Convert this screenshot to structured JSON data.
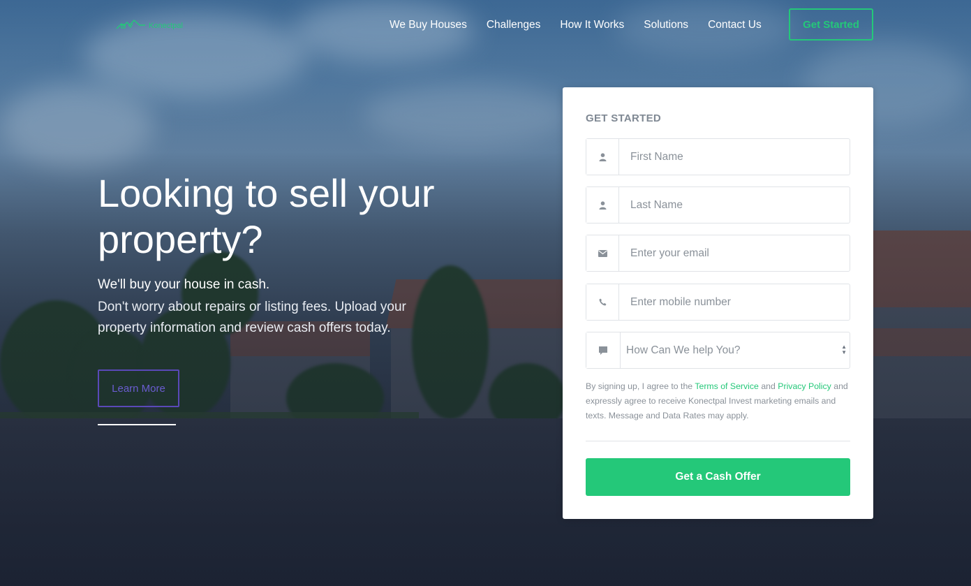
{
  "brand": {
    "name": "Konectpal",
    "accent_color": "#24c879",
    "secondary_color": "#5a49b8"
  },
  "nav": {
    "items": [
      "We Buy Houses",
      "Challenges",
      "How It Works",
      "Solutions",
      "Contact Us"
    ],
    "cta_label": "Get Started"
  },
  "hero": {
    "title": "Looking to sell your property?",
    "strong": "We'll buy your house in cash.",
    "subtitle": "Don't worry about repairs or listing fees. Upload your property information and review cash offers today.",
    "learn_more_label": "Learn More"
  },
  "form": {
    "title": "GET STARTED",
    "fields": {
      "first_name": {
        "placeholder": "First Name",
        "icon": "user-icon"
      },
      "last_name": {
        "placeholder": "Last Name",
        "icon": "user-icon"
      },
      "email": {
        "placeholder": "Enter your email",
        "icon": "envelope-icon"
      },
      "mobile": {
        "placeholder": "Enter mobile number",
        "icon": "phone-icon"
      },
      "help": {
        "selected": "How Can We help You?",
        "icon": "comment-icon"
      }
    },
    "terms": {
      "prefix": "By signing up, I agree to the ",
      "terms_link": "Terms of Service",
      "and": " and ",
      "privacy_link": "Privacy Policy",
      "suffix": " and expressly agree to receive Konectpal Invest marketing emails and texts. Message and Data Rates may apply."
    },
    "submit_label": "Get a Cash Offer"
  }
}
